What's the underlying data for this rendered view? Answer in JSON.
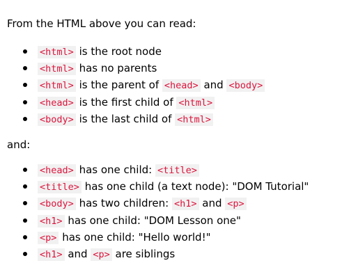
{
  "intro": "From the HTML above you can read:",
  "list1": [
    [
      {
        "t": "html",
        "c": true
      },
      {
        "t": " is the root node"
      }
    ],
    [
      {
        "t": "html",
        "c": true
      },
      {
        "t": " has no parents"
      }
    ],
    [
      {
        "t": "html",
        "c": true
      },
      {
        "t": " is the parent of "
      },
      {
        "t": "head",
        "c": true
      },
      {
        "t": " and "
      },
      {
        "t": "body",
        "c": true
      }
    ],
    [
      {
        "t": "head",
        "c": true
      },
      {
        "t": " is the first child of "
      },
      {
        "t": "html",
        "c": true
      }
    ],
    [
      {
        "t": "body",
        "c": true
      },
      {
        "t": " is the last child of "
      },
      {
        "t": "html",
        "c": true
      }
    ]
  ],
  "and_text": "and:",
  "list2": [
    [
      {
        "t": "head",
        "c": true
      },
      {
        "t": " has one child: "
      },
      {
        "t": "title",
        "c": true
      }
    ],
    [
      {
        "t": "title",
        "c": true
      },
      {
        "t": " has one child (a text node): \"DOM Tutorial\""
      }
    ],
    [
      {
        "t": "body",
        "c": true
      },
      {
        "t": " has two children: "
      },
      {
        "t": "h1",
        "c": true
      },
      {
        "t": " and "
      },
      {
        "t": "p",
        "c": true
      }
    ],
    [
      {
        "t": "h1",
        "c": true
      },
      {
        "t": " has one child: \"DOM Lesson one\""
      }
    ],
    [
      {
        "t": "p",
        "c": true
      },
      {
        "t": " has one child: \"Hello world!\""
      }
    ],
    [
      {
        "t": "h1",
        "c": true
      },
      {
        "t": " and "
      },
      {
        "t": "p",
        "c": true
      },
      {
        "t": " are siblings"
      }
    ]
  ],
  "colors": {
    "code_text": "#dc143c",
    "code_background": "#f1f1f1",
    "body_text": "#000000",
    "page_background": "#ffffff"
  }
}
